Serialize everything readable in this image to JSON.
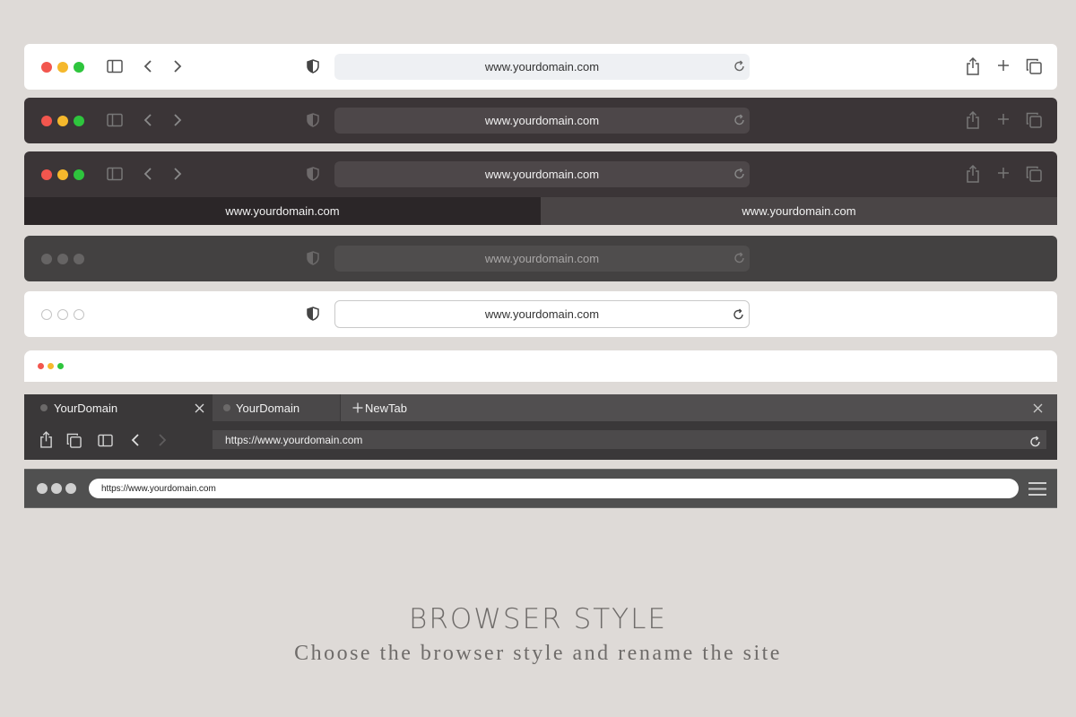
{
  "bar1": {
    "url": "www.yourdomain.com"
  },
  "bar2": {
    "url": "www.yourdomain.com"
  },
  "bar3": {
    "url": "www.yourdomain.com",
    "tabs": [
      "www.yourdomain.com",
      "www.yourdomain.com"
    ]
  },
  "bar4": {
    "url": "www.yourdomain.com"
  },
  "bar5": {
    "url": "www.yourdomain.com"
  },
  "bar7": {
    "tab1": "YourDomain",
    "tab2": "YourDomain",
    "new_tab": "NewTab",
    "url": "https://www.yourdomain.com"
  },
  "bar8": {
    "url": "https://www.yourdomain.com"
  },
  "caption": {
    "title": "BROWSER STYLE",
    "subtitle": "Choose the browser style and rename the site"
  },
  "colors": {
    "background": "#dedad7",
    "dark_bar": "#3b3537",
    "gray_bar": "#434141",
    "close": "#f2564e",
    "minimize": "#f5b82c",
    "zoom": "#2ec53d"
  },
  "icons": [
    "sidebar-icon",
    "back-icon",
    "forward-icon",
    "shield-icon",
    "reload-icon",
    "share-icon",
    "plus-icon",
    "tabs-icon",
    "close-icon",
    "hamburger-icon"
  ]
}
